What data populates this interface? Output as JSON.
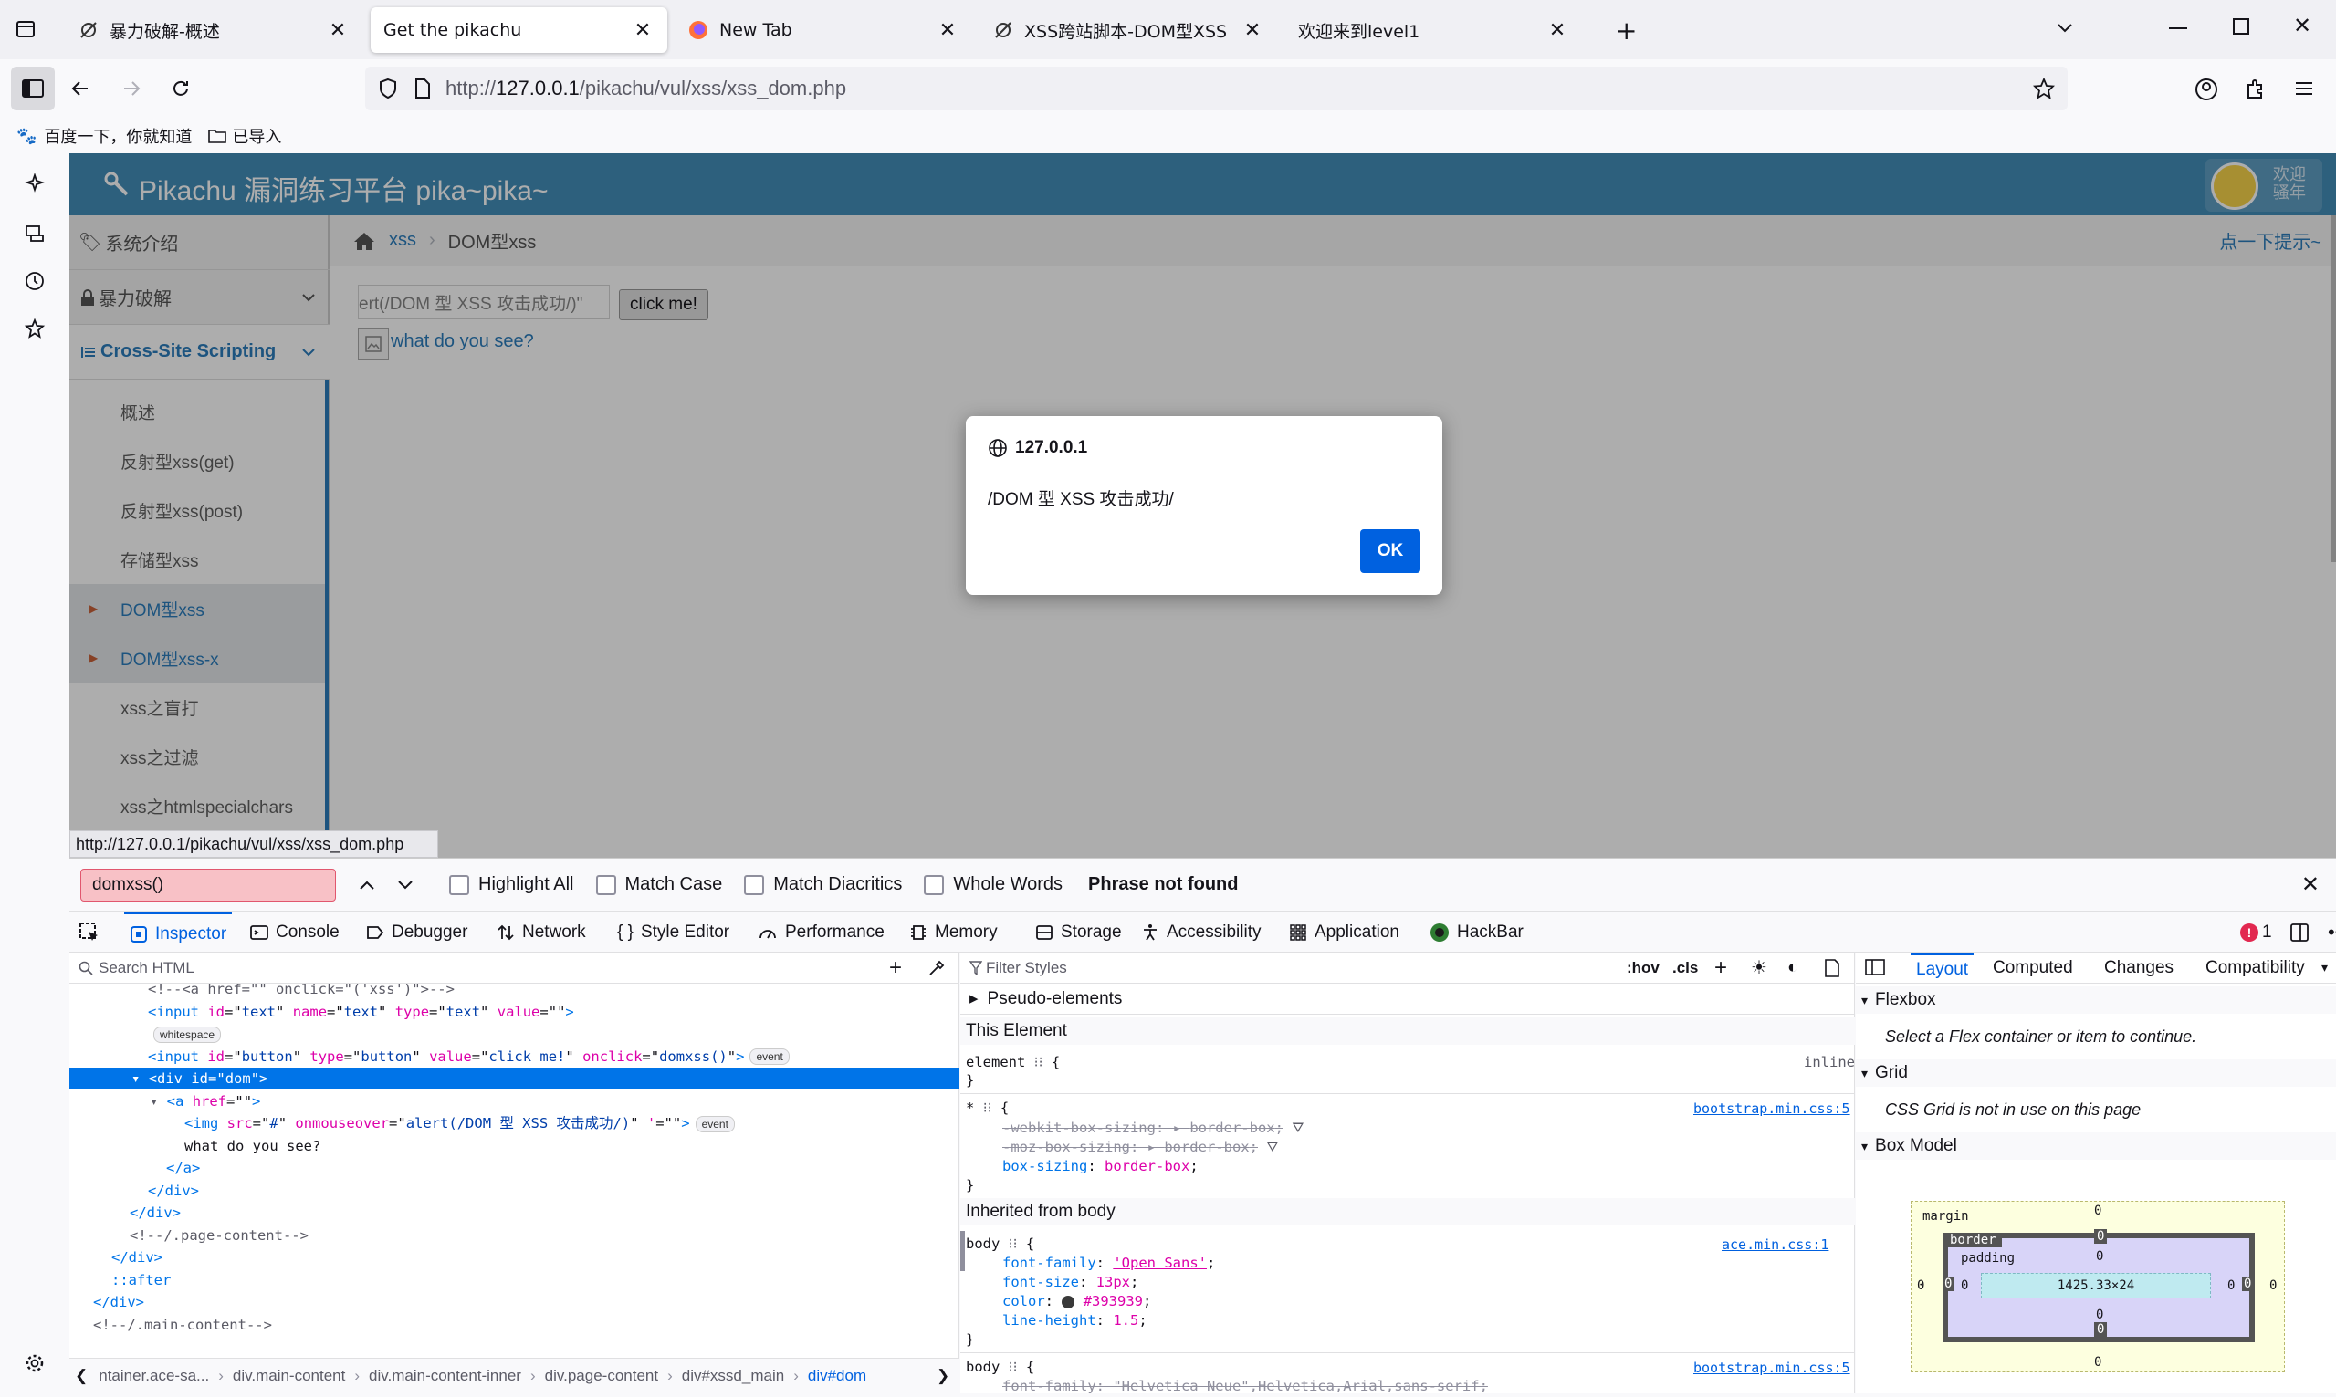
{
  "tabs": [
    {
      "title": "暴力破解-概述",
      "active": false
    },
    {
      "title": "Get the pikachu",
      "active": true
    },
    {
      "title": "New Tab",
      "active": false
    },
    {
      "title": "XSS跨站脚本-DOM型XSS",
      "active": false
    },
    {
      "title": "欢迎来到level1",
      "active": false
    }
  ],
  "url": {
    "prefix": "http://",
    "host": "127.0.0.1",
    "path": "/pikachu/vul/xss/xss_dom.php"
  },
  "bookmarks": [
    "百度一下，你就知道",
    "已导入"
  ],
  "site": {
    "title": "Pikachu 漏洞练习平台 pika~pika~",
    "welcome_line1": "欢迎",
    "welcome_line2": "骚年",
    "breadcrumb_link": "xss",
    "breadcrumb_current": "DOM型xss",
    "hint": "点一下提示~",
    "input_value": "ert(/DOM 型 XSS 攻击成功/)\"",
    "button_label": "click me!",
    "link_text": "what do you see?",
    "status_url": "http://127.0.0.1/pikachu/vul/xss/xss_dom.php"
  },
  "menu": {
    "items": [
      "系统介绍",
      "暴力破解",
      "Cross-Site Scripting"
    ],
    "subitems": [
      "概述",
      "反射型xss(get)",
      "反射型xss(post)",
      "存储型xss",
      "DOM型xss",
      "DOM型xss-x",
      "xss之盲打",
      "xss之过滤",
      "xss之htmlspecialchars"
    ]
  },
  "dialog": {
    "origin": "127.0.0.1",
    "message": "/DOM 型 XSS 攻击成功/",
    "ok": "OK"
  },
  "findbar": {
    "query": "domxss()",
    "options": [
      "Highlight All",
      "Match Case",
      "Match Diacritics",
      "Whole Words"
    ],
    "status": "Phrase not found"
  },
  "devtools": {
    "tabs": [
      "Inspector",
      "Console",
      "Debugger",
      "Network",
      "Style Editor",
      "Performance",
      "Memory",
      "Storage",
      "Accessibility",
      "Application",
      "HackBar"
    ],
    "error_count": "1",
    "search_placeholder": "Search HTML",
    "filter_placeholder": "Filter Styles",
    "hov": ":hov",
    "cls": ".cls",
    "breadcrumbs": [
      "ntainer.ace-sa...",
      "div.main-content",
      "div.main-content-inner",
      "div.page-content",
      "div#xssd_main",
      "div#dom"
    ],
    "layout_tabs": [
      "Layout",
      "Computed",
      "Changes",
      "Compatibility"
    ],
    "flexbox_title": "Flexbox",
    "flexbox_msg": "Select a Flex container or item to continue.",
    "grid_title": "Grid",
    "grid_msg": "CSS Grid is not in use on this page",
    "boxmodel_title": "Box Model",
    "box": {
      "margin_label": "margin",
      "border_label": "border",
      "padding_label": "padding",
      "content": "1425.33×24",
      "zero": "0"
    }
  },
  "html_lines": [
    {
      "indent": 0,
      "html": "<!--<a href=\"\" onclick=\"('xss')\">-->"
    },
    {
      "indent": 0,
      "tag": "input",
      "attrs": [
        [
          "id",
          "text"
        ],
        [
          "name",
          "text"
        ],
        [
          "type",
          "text"
        ],
        [
          "value",
          ""
        ]
      ]
    },
    {
      "indent": 0,
      "badge": "whitespace"
    },
    {
      "indent": 0,
      "tag": "input",
      "attrs": [
        [
          "id",
          "button"
        ],
        [
          "type",
          "button"
        ],
        [
          "value",
          "click me!"
        ],
        [
          "onclick",
          "domxss()"
        ]
      ],
      "badge": "event"
    },
    {
      "indent": 0,
      "tag": "div",
      "attrs": [
        [
          "id",
          "dom"
        ]
      ],
      "selected": true
    },
    {
      "indent": 1,
      "tag": "a",
      "attrs": [
        [
          "href",
          ""
        ]
      ]
    },
    {
      "indent": 2,
      "tag": "img",
      "attrs": [
        [
          "src",
          "#"
        ],
        [
          "onmouseover",
          "alert(/DOM 型 XSS 攻击成功/)"
        ],
        [
          "'",
          ""
        ]
      ],
      "badge": "event"
    },
    {
      "indent": 2,
      "text": "what do you see?"
    },
    {
      "indent": 1,
      "close": "a"
    },
    {
      "indent": 0,
      "close": "div"
    },
    {
      "indent": -1,
      "close": "div"
    },
    {
      "indent": -1,
      "comment": "<!--/.page-content-->"
    },
    {
      "indent": -2,
      "close": "div"
    },
    {
      "indent": -2,
      "pseudo": "::after"
    },
    {
      "indent": -3,
      "close": "div"
    },
    {
      "indent": -3,
      "comment": "<!--/.main-content-->"
    }
  ],
  "rules": {
    "pseudo_elements": "Pseudo-elements",
    "this_element": "This Element",
    "element_selector": "element",
    "element_display": "inline",
    "star_selector": "*",
    "star_source": "bootstrap.min.css:5",
    "star_props": [
      {
        "name": "-webkit-box-sizing",
        "value": "border-box",
        "struck": true
      },
      {
        "name": "-moz-box-sizing",
        "value": "border-box",
        "struck": true
      },
      {
        "name": "box-sizing",
        "value": "border-box",
        "struck": false
      }
    ],
    "inherited": "Inherited from body",
    "body_selector": "body",
    "body_source": "ace.min.css:1",
    "body_props": [
      {
        "name": "font-family",
        "value": "'Open Sans'"
      },
      {
        "name": "font-size",
        "value": "13px"
      },
      {
        "name": "color",
        "value": "#393939"
      },
      {
        "name": "line-height",
        "value": "1.5"
      }
    ],
    "body2_source": "bootstrap.min.css:5",
    "body2_prop": "font-family: \"Helvetica Neue\",Helvetica,Arial,sans-serif;"
  }
}
